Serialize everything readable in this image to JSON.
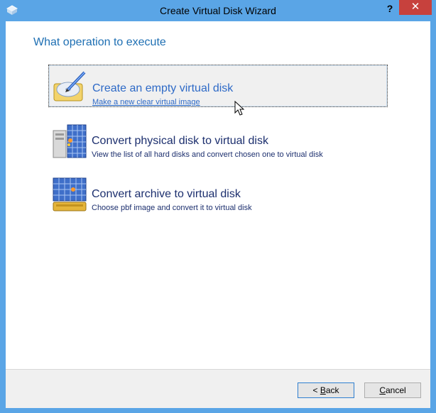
{
  "window": {
    "title": "Create Virtual Disk Wizard",
    "help_glyph": "?",
    "close_glyph": "✕"
  },
  "heading": "What operation to execute",
  "options": [
    {
      "title": "Create an empty virtual disk",
      "subtitle": "Make a new clear virtual image",
      "icon": "disk-pencil-icon",
      "selected": true
    },
    {
      "title": "Convert physical disk to virtual disk",
      "subtitle": "View the list of all hard disks and convert chosen one to virtual disk",
      "icon": "computer-grid-icon",
      "selected": false
    },
    {
      "title": "Convert archive to virtual disk",
      "subtitle": "Choose pbf image and convert it to virtual disk",
      "icon": "archive-grid-icon",
      "selected": false
    }
  ],
  "buttons": {
    "back_prefix": "< ",
    "back_underlined": "B",
    "back_rest": "ack",
    "cancel_underlined": "C",
    "cancel_rest": "ancel"
  },
  "colors": {
    "titlebar": "#5aa5e6",
    "close": "#c7413d",
    "heading": "#1e6fb3",
    "option_text": "#1c2f6e",
    "selected_text": "#2e6ac7"
  }
}
